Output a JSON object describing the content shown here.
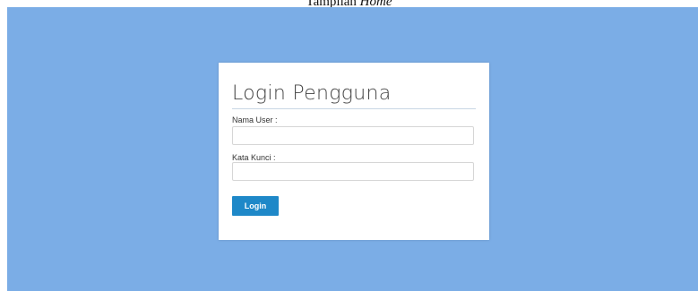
{
  "caption": {
    "prefix": "Tampilan ",
    "emphasis": "Home"
  },
  "login": {
    "title": "Login Pengguna",
    "username_label": "Nama User :",
    "username_value": "",
    "password_label": "Kata Kunci :",
    "password_value": "",
    "submit_label": "Login"
  },
  "colors": {
    "background": "#7bade6",
    "button": "#1e88c8"
  }
}
